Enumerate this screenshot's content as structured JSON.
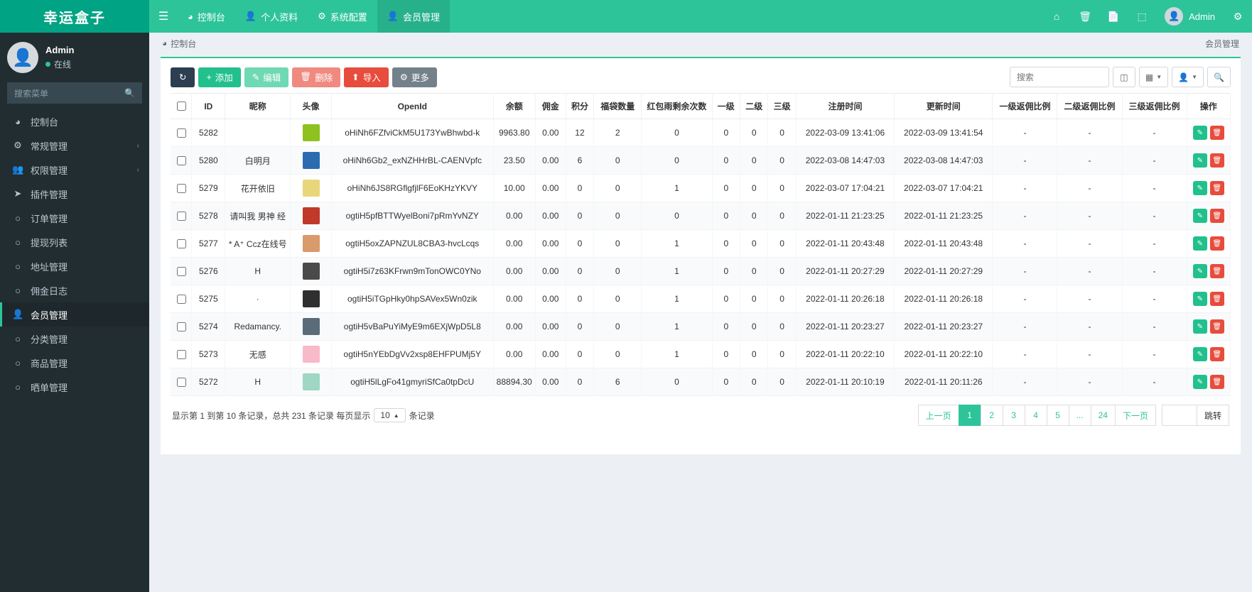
{
  "app": {
    "brand": "幸运盒子"
  },
  "topnav": {
    "toggle_icon": "hamburger-icon",
    "items": [
      {
        "label": "控制台",
        "icon": "dashboard-icon",
        "active": false
      },
      {
        "label": "个人资料",
        "icon": "user-icon",
        "active": false
      },
      {
        "label": "系统配置",
        "icon": "gear-icon",
        "active": false
      },
      {
        "label": "会员管理",
        "icon": "user-icon",
        "active": true
      }
    ],
    "right_icons": [
      "home-icon",
      "trash-icon",
      "copy-icon",
      "fullscreen-icon"
    ],
    "user_label": "Admin",
    "settings_icon": "gear-icon"
  },
  "sidebar": {
    "user": {
      "name": "Admin",
      "status": "在线"
    },
    "search_placeholder": "搜索菜单",
    "search_icon": "search-icon",
    "items": [
      {
        "label": "控制台",
        "icon": "dashboard-icon",
        "arrow": "",
        "active": false
      },
      {
        "label": "常规管理",
        "icon": "gears-icon",
        "arrow": "‹",
        "active": false
      },
      {
        "label": "权限管理",
        "icon": "users-icon",
        "arrow": "‹",
        "active": false
      },
      {
        "label": "插件管理",
        "icon": "rocket-icon",
        "arrow": "",
        "active": false
      },
      {
        "label": "订单管理",
        "icon": "circle-icon",
        "arrow": "",
        "active": false
      },
      {
        "label": "提现列表",
        "icon": "circle-icon",
        "arrow": "",
        "active": false
      },
      {
        "label": "地址管理",
        "icon": "circle-icon",
        "arrow": "",
        "active": false
      },
      {
        "label": "佣金日志",
        "icon": "circle-icon",
        "arrow": "",
        "active": false
      },
      {
        "label": "会员管理",
        "icon": "user-icon",
        "arrow": "",
        "active": true
      },
      {
        "label": "分类管理",
        "icon": "circle-icon",
        "arrow": "",
        "active": false
      },
      {
        "label": "商品管理",
        "icon": "circle-icon",
        "arrow": "",
        "active": false
      },
      {
        "label": "晒单管理",
        "icon": "circle-icon",
        "arrow": "",
        "active": false
      }
    ]
  },
  "breadcrumb": {
    "icon": "dashboard-icon",
    "text": "控制台",
    "right": "会员管理"
  },
  "toolbar": {
    "refresh_label": "",
    "refresh_icon": "refresh-icon",
    "add_label": "添加",
    "edit_label": "编辑",
    "delete_label": "删除",
    "import_label": "导入",
    "more_label": "更多",
    "search_placeholder": "搜索",
    "column_icon": "columns-icon",
    "grid_icon": "grid-icon",
    "export_icon": "export-icon",
    "search_icon": "search-icon"
  },
  "table": {
    "columns": [
      "ID",
      "昵称",
      "头像",
      "OpenId",
      "余额",
      "佣金",
      "积分",
      "福袋数量",
      "红包雨剩余次数",
      "一级",
      "二级",
      "三级",
      "注册时间",
      "更新时间",
      "一级返佣比例",
      "二级返佣比例",
      "三级返佣比例",
      "操作"
    ],
    "rows": [
      {
        "id": "5282",
        "nick": "",
        "avatar_color": "#8dc21f",
        "openid": "oHiNh6FZfviCkM5U173YwBhwbd-k",
        "balance": "9963.80",
        "commission": "0.00",
        "points": "12",
        "bags": "2",
        "redpacket": "0",
        "l1": "0",
        "l2": "0",
        "l3": "0",
        "reg": "2022-03-09 13:41:06",
        "upd": "2022-03-09 13:41:54",
        "r1": "-",
        "r2": "-",
        "r3": "-"
      },
      {
        "id": "5280",
        "nick": "白明月",
        "avatar_color": "#2b6cb0",
        "openid": "oHiNh6Gb2_exNZHHrBL-CAENVpfc",
        "balance": "23.50",
        "commission": "0.00",
        "points": "6",
        "bags": "0",
        "redpacket": "0",
        "l1": "0",
        "l2": "0",
        "l3": "0",
        "reg": "2022-03-08 14:47:03",
        "upd": "2022-03-08 14:47:03",
        "r1": "-",
        "r2": "-",
        "r3": "-"
      },
      {
        "id": "5279",
        "nick": "花开依旧",
        "avatar_color": "#e8d77a",
        "openid": "oHiNh6JS8RGflgfjlF6EoKHzYKVY",
        "balance": "10.00",
        "commission": "0.00",
        "points": "0",
        "bags": "0",
        "redpacket": "1",
        "l1": "0",
        "l2": "0",
        "l3": "0",
        "reg": "2022-03-07 17:04:21",
        "upd": "2022-03-07 17:04:21",
        "r1": "-",
        "r2": "-",
        "r3": "-"
      },
      {
        "id": "5278",
        "nick": "请叫我 男神 经",
        "avatar_color": "#c0392b",
        "openid": "ogtiH5pfBTTWyelBoni7pRmYvNZY",
        "balance": "0.00",
        "commission": "0.00",
        "points": "0",
        "bags": "0",
        "redpacket": "0",
        "l1": "0",
        "l2": "0",
        "l3": "0",
        "reg": "2022-01-11 21:23:25",
        "upd": "2022-01-11 21:23:25",
        "r1": "-",
        "r2": "-",
        "r3": "-"
      },
      {
        "id": "5277",
        "nick": "* A⁺ Ccz在线号",
        "avatar_color": "#d99a6c",
        "openid": "ogtiH5oxZAPNZUL8CBA3-hvcLcqs",
        "balance": "0.00",
        "commission": "0.00",
        "points": "0",
        "bags": "0",
        "redpacket": "1",
        "l1": "0",
        "l2": "0",
        "l3": "0",
        "reg": "2022-01-11 20:43:48",
        "upd": "2022-01-11 20:43:48",
        "r1": "-",
        "r2": "-",
        "r3": "-"
      },
      {
        "id": "5276",
        "nick": "H",
        "avatar_color": "#4a4a4a",
        "openid": "ogtiH5i7z63KFrwn9mTonOWC0YNo",
        "balance": "0.00",
        "commission": "0.00",
        "points": "0",
        "bags": "0",
        "redpacket": "1",
        "l1": "0",
        "l2": "0",
        "l3": "0",
        "reg": "2022-01-11 20:27:29",
        "upd": "2022-01-11 20:27:29",
        "r1": "-",
        "r2": "-",
        "r3": "-"
      },
      {
        "id": "5275",
        "nick": "·",
        "avatar_color": "#2f2f2f",
        "openid": "ogtiH5iTGpHky0hpSAVex5Wn0zik",
        "balance": "0.00",
        "commission": "0.00",
        "points": "0",
        "bags": "0",
        "redpacket": "1",
        "l1": "0",
        "l2": "0",
        "l3": "0",
        "reg": "2022-01-11 20:26:18",
        "upd": "2022-01-11 20:26:18",
        "r1": "-",
        "r2": "-",
        "r3": "-"
      },
      {
        "id": "5274",
        "nick": "Redamancy.",
        "avatar_color": "#5b6b78",
        "openid": "ogtiH5vBaPuYiMyE9m6EXjWpD5L8",
        "balance": "0.00",
        "commission": "0.00",
        "points": "0",
        "bags": "0",
        "redpacket": "1",
        "l1": "0",
        "l2": "0",
        "l3": "0",
        "reg": "2022-01-11 20:23:27",
        "upd": "2022-01-11 20:23:27",
        "r1": "-",
        "r2": "-",
        "r3": "-"
      },
      {
        "id": "5273",
        "nick": "无感",
        "avatar_color": "#f8b9c8",
        "openid": "ogtiH5nYEbDgVv2xsp8EHFPUMj5Y",
        "balance": "0.00",
        "commission": "0.00",
        "points": "0",
        "bags": "0",
        "redpacket": "1",
        "l1": "0",
        "l2": "0",
        "l3": "0",
        "reg": "2022-01-11 20:22:10",
        "upd": "2022-01-11 20:22:10",
        "r1": "-",
        "r2": "-",
        "r3": "-"
      },
      {
        "id": "5272",
        "nick": "H",
        "avatar_color": "#9fd6c4",
        "openid": "ogtiH5lLgFo41gmyriSfCa0tpDcU",
        "balance": "88894.30",
        "commission": "0.00",
        "points": "0",
        "bags": "6",
        "redpacket": "0",
        "l1": "0",
        "l2": "0",
        "l3": "0",
        "reg": "2022-01-11 20:10:19",
        "upd": "2022-01-11 20:11:26",
        "r1": "-",
        "r2": "-",
        "r3": "-"
      }
    ],
    "row_edit_icon": "pencil-icon",
    "row_delete_icon": "trash-icon"
  },
  "footer": {
    "info_prefix": "显示第 1 到第 10 条记录，总共 231 条记录 每页显示",
    "page_size": "10",
    "info_suffix": "条记录",
    "prev_label": "上一页",
    "next_label": "下一页",
    "pages": [
      "1",
      "2",
      "3",
      "4",
      "5",
      "...",
      "24"
    ],
    "current_page": "1",
    "jump_value": "",
    "jump_label": "跳转"
  },
  "colors": {
    "brand_dark": "#00a383",
    "brand": "#2ec49a",
    "sidebar": "#222d32",
    "danger": "#e74c3c"
  }
}
